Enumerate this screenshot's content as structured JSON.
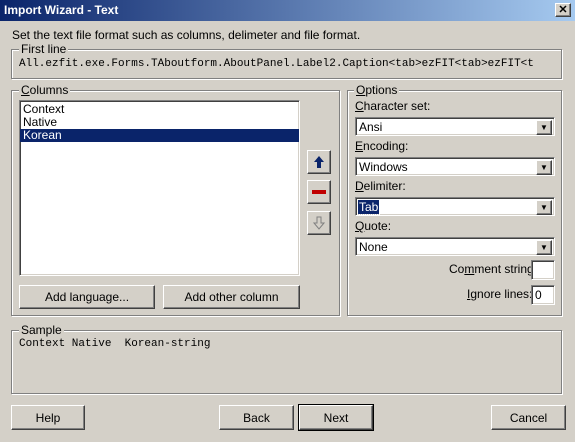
{
  "window": {
    "title": "Import Wizard - Text",
    "close_glyph": "✕"
  },
  "instructions": "Set the text file format such as columns, delimeter and file format.",
  "first_line": {
    "label": "First line",
    "text": "All.ezfit.exe.Forms.TAboutform.AboutPanel.Label2.Caption<tab>ezFIT<tab>ezFIT<t"
  },
  "columns": {
    "label": "Columns",
    "items": [
      "Context",
      "Native",
      "Korean"
    ],
    "selected": "Korean",
    "move_up_icon": "up-arrow-icon",
    "remove_icon": "minus-icon",
    "move_down_icon": "down-arrow-icon",
    "add_language_label": "Add language...",
    "add_other_label": "Add other column"
  },
  "options": {
    "label": "Options",
    "charset": {
      "label": "Character set:",
      "value": "Ansi"
    },
    "encoding": {
      "label": "Encoding:",
      "value": "Windows"
    },
    "delimiter": {
      "label": "Delimiter:",
      "value": "Tab"
    },
    "quote": {
      "label": "Quote:",
      "value": "None"
    },
    "comment": {
      "label": "Comment string:",
      "value": ""
    },
    "ignore": {
      "label": "Ignore lines:",
      "value": "0"
    }
  },
  "sample": {
    "label": "Sample",
    "text": "Context Native  Korean-string"
  },
  "buttons": {
    "help": "Help",
    "back": "Back",
    "next": "Next",
    "cancel": "Cancel"
  },
  "colors": {
    "selection": "#0a246a",
    "up_arrow": "#0a246a",
    "remove": "#c00000"
  }
}
